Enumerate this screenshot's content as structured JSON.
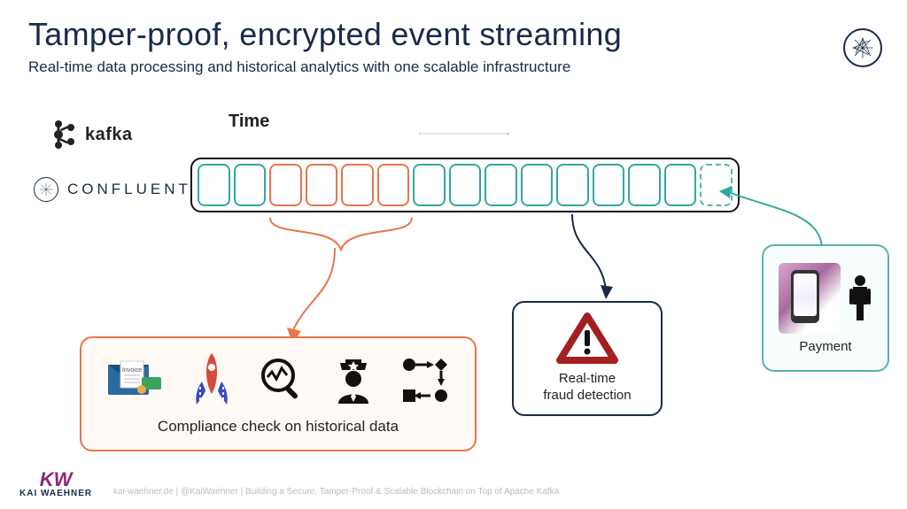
{
  "title": "Tamper-proof, encrypted event streaming",
  "subtitle": "Real-time data processing and historical analytics with one scalable infrastructure",
  "logos": {
    "kafka": "kafka",
    "confluent": "CONFLUENT"
  },
  "timeline": {
    "label": "Time",
    "block_colors": [
      "teal",
      "teal",
      "orange",
      "orange",
      "orange",
      "orange",
      "teal",
      "teal",
      "teal",
      "teal",
      "teal",
      "teal",
      "teal",
      "teal",
      "dashed"
    ]
  },
  "compliance": {
    "label": "Compliance check on historical data",
    "icons": [
      "invoice-icon",
      "rocket-icon",
      "analytics-icon",
      "police-icon",
      "workflow-icon"
    ]
  },
  "fraud": {
    "label_line1": "Real-time",
    "label_line2": "fraud detection"
  },
  "payment": {
    "label": "Payment"
  },
  "footer": {
    "author_initials": "KW",
    "author_name": "KAI WAEHNER",
    "credit": "kai-waehner.de | @KaiWaehner | Building a Secure, Tamper-Proof & Scalable Blockchain on Top of Apache Kafka"
  },
  "colors": {
    "navy": "#1a2a4a",
    "teal": "#2fa9a0",
    "orange": "#e9744a",
    "red": "#a32020"
  }
}
